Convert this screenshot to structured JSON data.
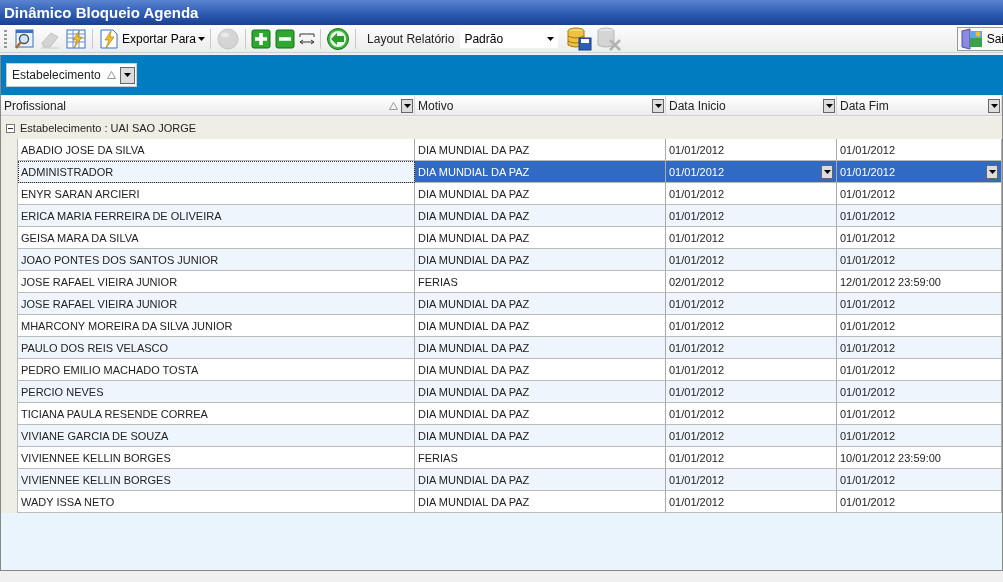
{
  "window": {
    "title": "Dinâmico Bloqueio Agenda"
  },
  "toolbar": {
    "buttons": [
      {
        "disabled": false
      },
      {
        "disabled": true
      },
      {
        "disabled": false
      }
    ],
    "export_menu": {
      "label": "Exportar Para"
    },
    "edit_buttons": [
      {
        "disabled": true
      },
      {
        "disabled": false
      },
      {
        "disabled": false
      },
      {
        "disabled": false
      },
      {
        "disabled": false
      }
    ],
    "layout_label": "Layout Relatório",
    "layout_select": {
      "value": "Padrão"
    },
    "data_buttons": [
      {
        "disabled": false
      },
      {
        "disabled": true
      }
    ],
    "exit_button": {
      "label": "Sai"
    }
  },
  "group_panel": {
    "chips": [
      {
        "label": "Estabelecimento",
        "sorted": true
      }
    ]
  },
  "table": {
    "columns": [
      {
        "label": "Profissional",
        "sorted": true
      },
      {
        "label": "Motivo",
        "sorted": false
      },
      {
        "label": "Data Inicio",
        "sorted": false
      },
      {
        "label": "Data Fim",
        "sorted": false
      }
    ],
    "group": {
      "label": "Estabelecimento : UAI SAO JORGE",
      "expanded": true
    },
    "rows": [
      {
        "cells": [
          "ABADIO JOSE DA SILVA",
          "DIA MUNDIAL DA PAZ",
          "01/01/2012",
          "01/01/2012"
        ],
        "selected": false
      },
      {
        "cells": [
          "ADMINISTRADOR",
          "DIA MUNDIAL DA PAZ",
          "01/01/2012",
          "01/01/2012"
        ],
        "selected": true
      },
      {
        "cells": [
          "ENYR SARAN ARCIERI",
          "DIA MUNDIAL DA PAZ",
          "01/01/2012",
          "01/01/2012"
        ],
        "selected": false
      },
      {
        "cells": [
          "ERICA MARIA FERREIRA DE OLIVEIRA",
          "DIA MUNDIAL DA PAZ",
          "01/01/2012",
          "01/01/2012"
        ],
        "selected": false
      },
      {
        "cells": [
          "GEISA MARA DA SILVA",
          "DIA MUNDIAL DA PAZ",
          "01/01/2012",
          "01/01/2012"
        ],
        "selected": false
      },
      {
        "cells": [
          "JOAO PONTES DOS SANTOS JUNIOR",
          "DIA MUNDIAL DA PAZ",
          "01/01/2012",
          "01/01/2012"
        ],
        "selected": false
      },
      {
        "cells": [
          "JOSE RAFAEL VIEIRA JUNIOR",
          "FERIAS",
          "02/01/2012",
          "12/01/2012 23:59:00"
        ],
        "selected": false
      },
      {
        "cells": [
          "JOSE RAFAEL VIEIRA JUNIOR",
          "DIA MUNDIAL DA PAZ",
          "01/01/2012",
          "01/01/2012"
        ],
        "selected": false
      },
      {
        "cells": [
          "MHARCONY MOREIRA DA SILVA JUNIOR",
          "DIA MUNDIAL DA PAZ",
          "01/01/2012",
          "01/01/2012"
        ],
        "selected": false
      },
      {
        "cells": [
          "PAULO DOS REIS VELASCO",
          "DIA MUNDIAL DA PAZ",
          "01/01/2012",
          "01/01/2012"
        ],
        "selected": false
      },
      {
        "cells": [
          "PEDRO EMILIO MACHADO TOSTA",
          "DIA MUNDIAL DA PAZ",
          "01/01/2012",
          "01/01/2012"
        ],
        "selected": false
      },
      {
        "cells": [
          "PERCIO NEVES",
          "DIA MUNDIAL DA PAZ",
          "01/01/2012",
          "01/01/2012"
        ],
        "selected": false
      },
      {
        "cells": [
          "TICIANA PAULA RESENDE CORREA",
          "DIA MUNDIAL DA PAZ",
          "01/01/2012",
          "01/01/2012"
        ],
        "selected": false
      },
      {
        "cells": [
          "VIVIANE GARCIA DE SOUZA",
          "DIA MUNDIAL DA PAZ",
          "01/01/2012",
          "01/01/2012"
        ],
        "selected": false
      },
      {
        "cells": [
          "VIVIENNEE KELLIN BORGES",
          "FERIAS",
          "01/01/2012",
          "10/01/2012 23:59:00"
        ],
        "selected": false
      },
      {
        "cells": [
          "VIVIENNEE KELLIN BORGES",
          "DIA MUNDIAL DA PAZ",
          "01/01/2012",
          "01/01/2012"
        ],
        "selected": false
      },
      {
        "cells": [
          "WADY ISSA NETO",
          "DIA MUNDIAL DA PAZ",
          "01/01/2012",
          "01/01/2012"
        ],
        "selected": false
      }
    ]
  }
}
